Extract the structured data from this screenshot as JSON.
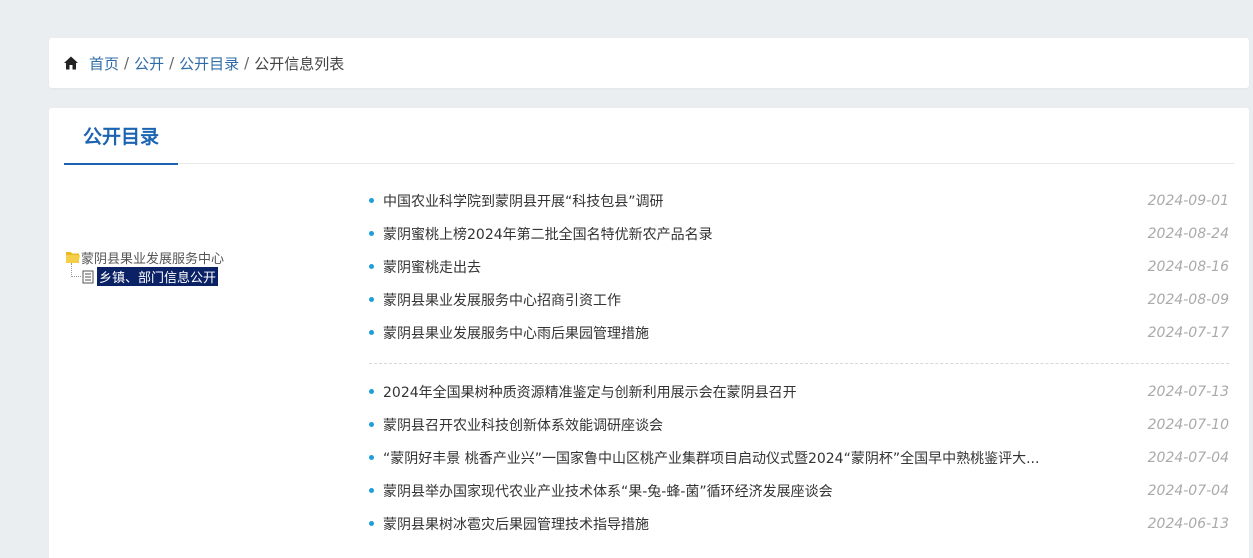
{
  "breadcrumb": {
    "items": [
      "首页",
      "公开",
      "公开目录"
    ],
    "separator": "/",
    "current": "公开信息列表"
  },
  "tab": {
    "label": "公开目录"
  },
  "tree": {
    "root": "蒙阴县果业发展服务中心",
    "child": "乡镇、部门信息公开"
  },
  "news": {
    "group1": [
      {
        "title": "中国农业科学院到蒙阴县开展“科技包县”调研",
        "date": "2024-09-01"
      },
      {
        "title": "蒙阴蜜桃上榜2024年第二批全国名特优新农产品名录",
        "date": "2024-08-24"
      },
      {
        "title": "蒙阴蜜桃走出去",
        "date": "2024-08-16"
      },
      {
        "title": "蒙阴县果业发展服务中心招商引资工作",
        "date": "2024-08-09"
      },
      {
        "title": "蒙阴县果业发展服务中心雨后果园管理措施",
        "date": "2024-07-17"
      }
    ],
    "group2": [
      {
        "title": "2024年全国果树种质资源精准鉴定与创新利用展示会在蒙阴县召开",
        "date": "2024-07-13"
      },
      {
        "title": "蒙阴县召开农业科技创新体系效能调研座谈会",
        "date": "2024-07-10"
      },
      {
        "title": "“蒙阴好丰景 桃香产业兴”一国家鲁中山区桃产业集群项目启动仪式暨2024“蒙阴杯”全国早中熟桃鉴评大...",
        "date": "2024-07-04"
      },
      {
        "title": "蒙阴县举办国家现代农业产业技术体系“果-兔-蜂-菌”循环经济发展座谈会",
        "date": "2024-07-04"
      },
      {
        "title": "蒙阴县果树冰雹灾后果园管理技术指导措施",
        "date": "2024-06-13"
      }
    ]
  },
  "colors": {
    "accent": "#1b64b2",
    "link": "#2e6ca8",
    "bullet": "#1f9ed9",
    "tree_selected": "#0a2265"
  }
}
